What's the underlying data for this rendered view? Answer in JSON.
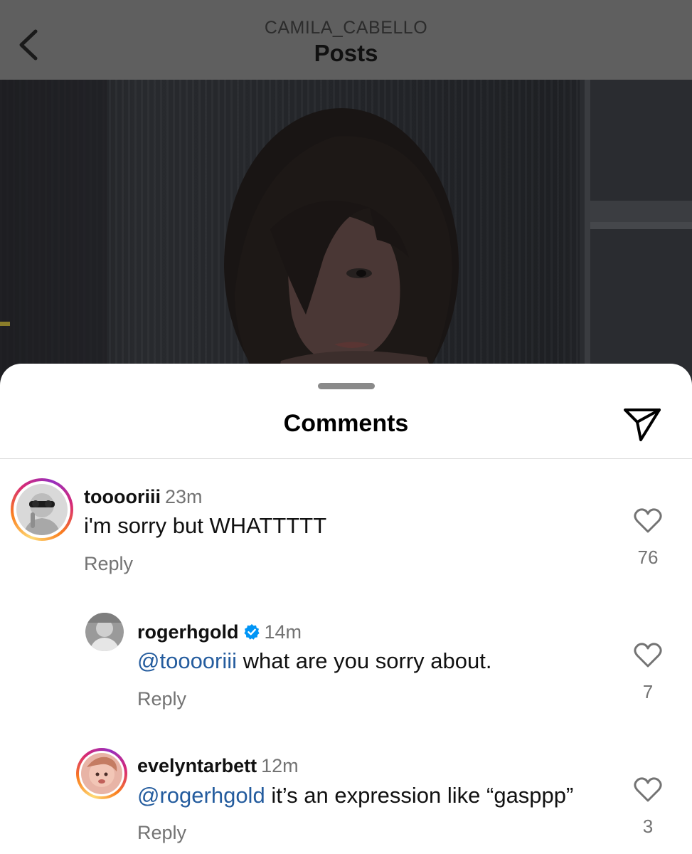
{
  "header": {
    "back_label": "back",
    "username": "CAMILA_CABELLO",
    "title": "Posts"
  },
  "sheet": {
    "title": "Comments",
    "share_icon": "paper-plane-icon"
  },
  "comments": [
    {
      "username": "tooooriii",
      "time": "23m",
      "text": "i'm sorry but WHATTTTT",
      "reply_label": "Reply",
      "likes": "76",
      "has_story_ring": true
    },
    {
      "username": "rogerhgold",
      "verified": true,
      "time": "14m",
      "mention": "@tooooriii",
      "text": " what are you sorry about.",
      "reply_label": "Reply",
      "likes": "7",
      "has_story_ring": false
    },
    {
      "username": "evelyntarbett",
      "time": "12m",
      "mention": "@rogerhgold",
      "text": " it’s an expression like “gasppp”",
      "reply_label": "Reply",
      "likes": "3",
      "has_story_ring": true
    }
  ],
  "colors": {
    "mention": "#245c9e",
    "secondary_text": "#737373",
    "verified_badge": "#0095f6"
  }
}
